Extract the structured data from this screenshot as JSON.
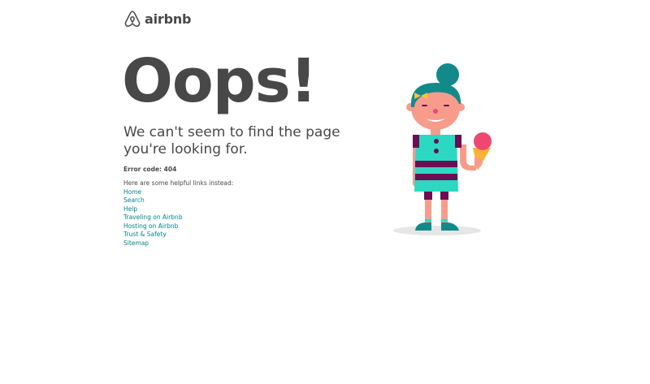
{
  "logo": {
    "text": "airbnb",
    "icon": "airbnb-belo-icon",
    "color": "#FF5A5F"
  },
  "main": {
    "headline": "Oops!",
    "subhead_line1": "We can't seem to find the page",
    "subhead_line2": "you're looking for.",
    "error_code": "Error code: 404",
    "links_intro": "Here are some helpful links instead:",
    "links": [
      {
        "label": "Home"
      },
      {
        "label": "Search"
      },
      {
        "label": "Help"
      },
      {
        "label": "Traveling on Airbnb"
      },
      {
        "label": "Hosting on Airbnb"
      },
      {
        "label": "Trust & Safety"
      },
      {
        "label": "Sitemap"
      }
    ]
  },
  "colors": {
    "text": "#484848",
    "link": "#008489",
    "accent_teal": "#2bd9c2",
    "dress_stripe": "#6b0e53",
    "hair": "#138a8a"
  },
  "illustration": {
    "name": "girl-with-ice-cream-illustration"
  }
}
